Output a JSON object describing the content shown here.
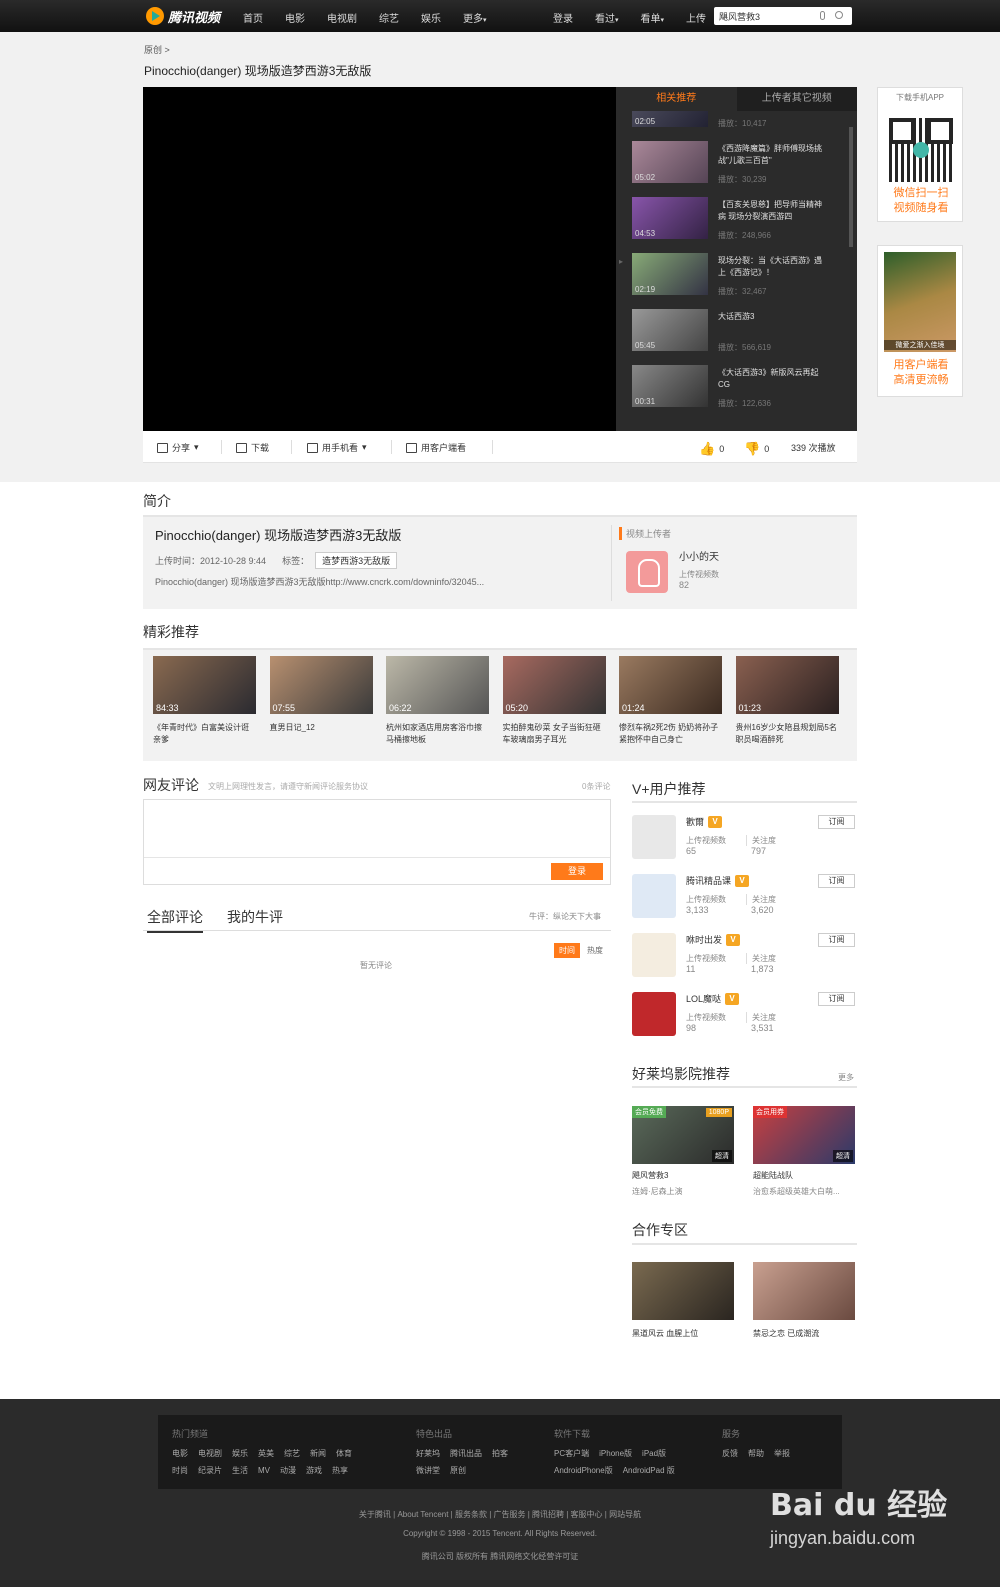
{
  "nav": {
    "logo_text": "腾讯视频",
    "left": [
      "首页",
      "电影",
      "电视剧",
      "综艺",
      "娱乐",
      "更多"
    ],
    "right": [
      "登录",
      "看过",
      "看单",
      "上传"
    ],
    "search_value": "飓风营救3"
  },
  "breadcrumb": "原创 >",
  "video_title": "Pinocchio(danger) 现场版造梦西游3无敌版",
  "playlist": {
    "tabs": [
      "相关推荐",
      "上传者其它视频"
    ],
    "items": [
      {
        "dur": "02:05",
        "title": "",
        "views": "播放：10,417"
      },
      {
        "dur": "05:02",
        "title": "《西游降魔篇》胖师傅现场挑战\"儿歌三百首\"",
        "views": "播放：30,239"
      },
      {
        "dur": "04:53",
        "title": "【百亥关恩慈】把导师当精神病 现场分裂演西游四",
        "views": "播放：248,966"
      },
      {
        "dur": "02:19",
        "title": "现场分裂：当《大话西游》遇上《西游记》！",
        "views": "播放：32,467"
      },
      {
        "dur": "05:45",
        "title": "大话西游3",
        "views": "播放：566,619"
      },
      {
        "dur": "00:31",
        "title": "《大话西游3》新版风云再起CG",
        "views": "播放：122,636"
      }
    ]
  },
  "toolbar": {
    "share": "分享",
    "download": "下载",
    "mobile": "用手机看",
    "client": "用客户端看",
    "likes": "0",
    "dislikes": "0",
    "plays": "339 次播放"
  },
  "app": {
    "header": "下载手机APP",
    "line1": "微信扫一扫",
    "line2": "视频随身看"
  },
  "client": {
    "poster_caption": "微爱之渐入佳境",
    "line1": "用客户端看",
    "line2": "高清更流畅"
  },
  "intro": {
    "section": "简介",
    "title": "Pinocchio(danger) 现场版造梦西游3无敌版",
    "upload_time": "上传时间：2012-10-28 9:44",
    "tag_label": "标签：",
    "tag": "造梦西游3无敌版",
    "desc": "Pinocchio(danger) 现场版造梦西游3无敌版http://www.cncrk.com/downinfo/32045...",
    "uploader_label": "视频上传者",
    "uploader_name": "小小的天",
    "uploader_count_label": "上传视频数",
    "uploader_count": "82"
  },
  "featured": {
    "section": "精彩推荐",
    "items": [
      {
        "dur": "84:33",
        "cap": "《年青时代》白富美设计诳亲爹"
      },
      {
        "dur": "07:55",
        "cap": "直男日记_12"
      },
      {
        "dur": "06:22",
        "cap": "杭州如家酒店用房客浴巾擦马桶擦地板"
      },
      {
        "dur": "05:20",
        "cap": "实拍醉鬼砂菜 女子当街狂砸车玻璃扇男子耳光"
      },
      {
        "dur": "01:24",
        "cap": "惨烈车祸2死2伤 奶奶将孙子紧抱怀中自己身亡"
      },
      {
        "dur": "01:23",
        "cap": "贵州16岁少女陪县规划局5名职员喝酒醉死"
      }
    ]
  },
  "comments": {
    "section": "网友评论",
    "hint": "文明上网理性发言，请遵守新闻评论服务协议",
    "count": "0条评论",
    "submit": "登录",
    "tab_all": "全部评论",
    "tab_mine": "我的牛评",
    "tab_right": "牛评：纵论天下大事",
    "sort_time": "时间",
    "sort_hot": "热度",
    "empty": "暂无评论"
  },
  "vplus": {
    "section": "V+用户推荐",
    "count_label": "上传视频数",
    "follow_label": "关注度",
    "subscribe": "订阅",
    "items": [
      {
        "name": "歡爾",
        "videos": "65",
        "follows": "797",
        "color": "#e8e8e8"
      },
      {
        "name": "腾讯精品课",
        "videos": "3,133",
        "follows": "3,620",
        "color": "#dfe9f5"
      },
      {
        "name": "咻时出发",
        "videos": "11",
        "follows": "1,873",
        "color": "#f4ede0"
      },
      {
        "name": "LOL魔哒",
        "videos": "98",
        "follows": "3,531",
        "color": "#c0282b"
      }
    ]
  },
  "hollywood": {
    "section": "好莱坞影院推荐",
    "more": "更多",
    "items": [
      {
        "title": "飓风营救3",
        "sub": "连姆·尼森上演",
        "badge": "会员免费",
        "quality": "超清",
        "tag": "1080P"
      },
      {
        "title": "超能陆战队",
        "sub": "治愈系超级英雄大白萌...",
        "badge": "会员用券",
        "quality": "超清",
        "tag": ""
      }
    ]
  },
  "coop": {
    "section": "合作专区",
    "items": [
      {
        "title": "黑道风云 血腥上位"
      },
      {
        "title": "禁忌之恋 已成潮流"
      }
    ]
  },
  "footer": {
    "cols": [
      {
        "h": "热门频道",
        "rows": [
          [
            "电影",
            "电视剧",
            "娱乐",
            "英美",
            "综艺",
            "新闻",
            "体育"
          ],
          [
            "时尚",
            "纪录片",
            "生活",
            "MV",
            "动漫",
            "游戏",
            "热享"
          ]
        ]
      },
      {
        "h": "特色出品",
        "rows": [
          [
            "好莱坞",
            "腾讯出品",
            "拍客"
          ],
          [
            "微讲堂",
            "原创"
          ]
        ]
      },
      {
        "h": "软件下载",
        "rows": [
          [
            "PC客户端",
            "iPhone版",
            "iPad版"
          ],
          [
            "AndroidPhone版",
            "AndroidPad 版"
          ]
        ]
      },
      {
        "h": "服务",
        "rows": [
          [
            "反馈",
            "帮助",
            "举报"
          ]
        ]
      }
    ],
    "links": "关于腾讯 | About Tencent | 服务条款 | 广告服务 | 腾讯招聘 | 客服中心 | 网站导航",
    "copyright": "Copyright © 1998 - 2015 Tencent. All Rights Reserved.",
    "license": "腾讯公司 版权所有 腾讯网络文化经营许可证"
  },
  "watermark": {
    "logo": "Bai du 经验",
    "sub": "jingyan.baidu.com"
  }
}
